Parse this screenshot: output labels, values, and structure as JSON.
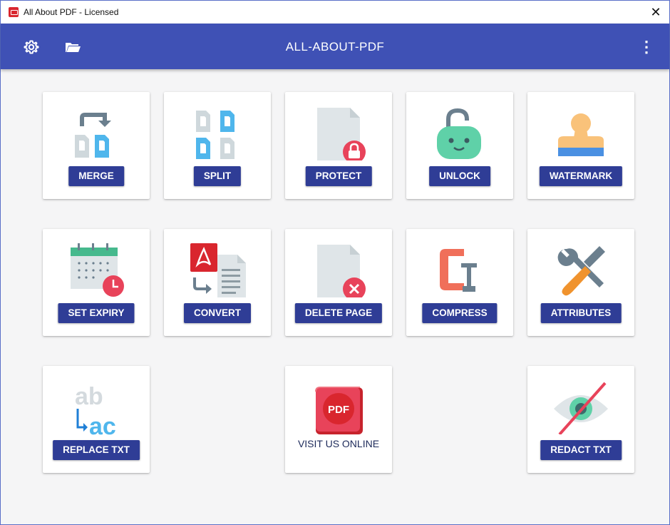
{
  "window": {
    "title": "All About PDF - Licensed",
    "close_label": "✕"
  },
  "appbar": {
    "title": "ALL-ABOUT-PDF",
    "more_label": "⋮"
  },
  "tiles": {
    "merge": "MERGE",
    "split": "SPLIT",
    "protect": "PROTECT",
    "unlock": "UNLOCK",
    "watermark": "WATERMARK",
    "set_expiry": "SET EXPIRY",
    "convert": "CONVERT",
    "delete_page": "DELETE PAGE",
    "compress": "COMPRESS",
    "attributes": "ATTRIBUTES",
    "replace_txt": "REPLACE TXT",
    "visit_online": "VISIT US ONLINE",
    "redact_txt": "REDACT TXT"
  },
  "icon_text": {
    "pdf_badge": "PDF",
    "ab": "ab",
    "ac": "ac"
  },
  "colors": {
    "appbar": "#3f51b5",
    "button": "#2f3d96",
    "accent_red": "#e8435a",
    "teal": "#5fd1a8"
  }
}
